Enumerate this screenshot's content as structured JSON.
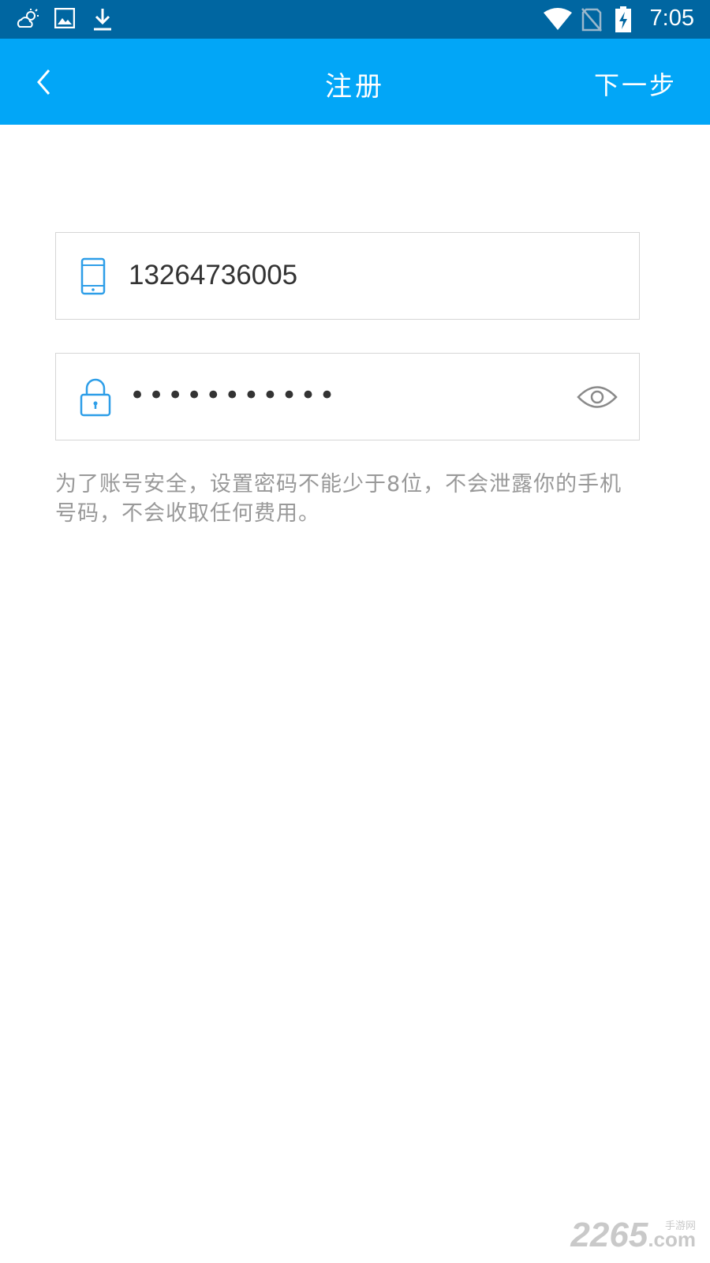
{
  "status_bar": {
    "time": "7:05",
    "left_icons": [
      "weather-cloud-icon",
      "image-icon",
      "download-icon"
    ],
    "right_icons": [
      "wifi-icon",
      "no-sim-icon",
      "battery-charging-icon"
    ]
  },
  "app_bar": {
    "title": "注册",
    "next_label": "下一步",
    "back_icon": "chevron-left-icon",
    "color": "#02a6f7"
  },
  "form": {
    "phone": {
      "value": "13264736005",
      "icon": "phone-icon"
    },
    "password": {
      "masked_value": "•••••••••••",
      "icon": "lock-icon",
      "toggle_icon": "eye-icon"
    },
    "hint": "为了账号安全，设置密码不能少于8位，不会泄露你的手机号码，不会收取任何费用。"
  },
  "watermark": {
    "number": "2265",
    "site": "手游网",
    "domain": ".com"
  },
  "colors": {
    "status_bar": "#0066a1",
    "accent": "#02a6f7",
    "icon_blue": "#2d9ee8",
    "hint_text": "#999999"
  }
}
